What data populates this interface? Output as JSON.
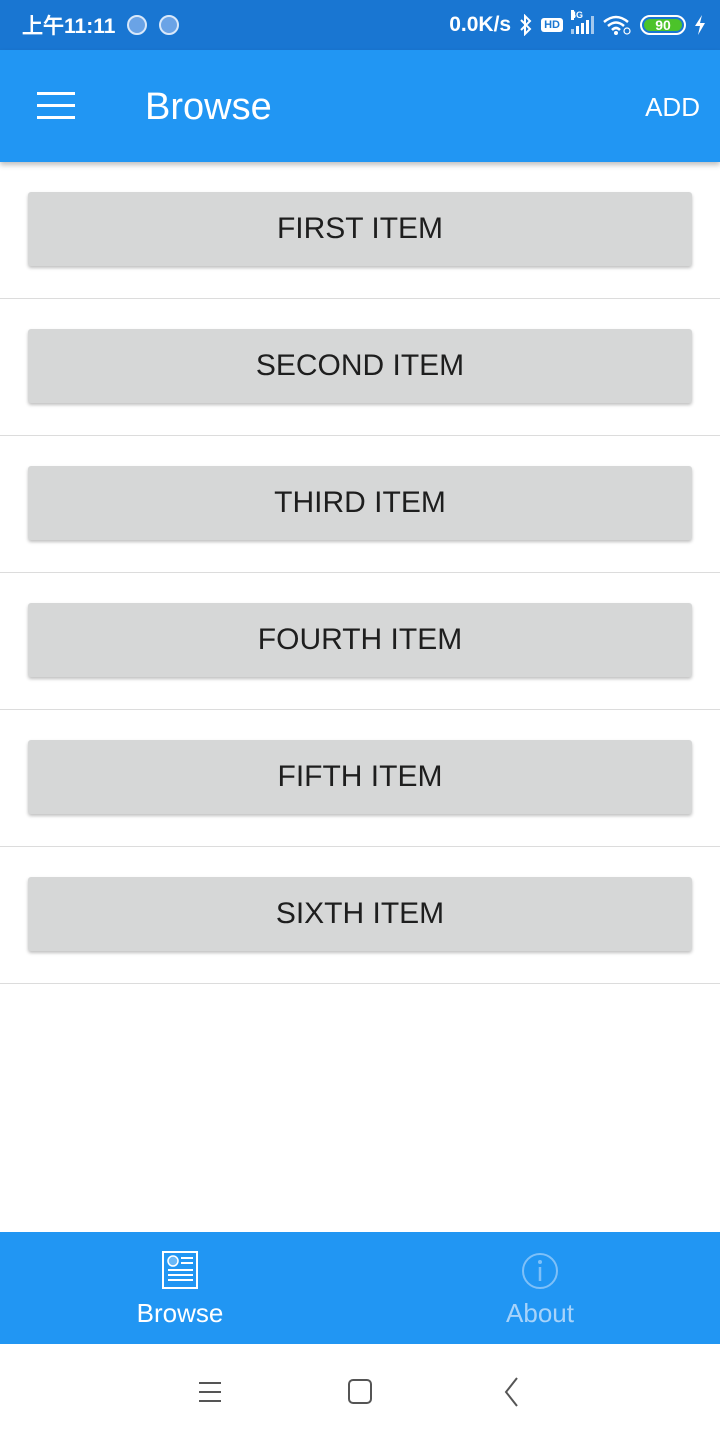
{
  "status_bar": {
    "time": "上午11:11",
    "net_speed": "0.0K/s",
    "hd_label": "HD",
    "network_type": "4G",
    "battery_level": "90",
    "icons": [
      "loading-icon",
      "loading-icon",
      "bluetooth-icon",
      "hd-icon",
      "signal-icon",
      "wifi-icon",
      "battery-icon",
      "charging-icon"
    ]
  },
  "app_bar": {
    "title": "Browse",
    "add_label": "ADD",
    "menu_icon": "hamburger-menu-icon"
  },
  "items": [
    {
      "label": "FIRST ITEM"
    },
    {
      "label": "SECOND ITEM"
    },
    {
      "label": "THIRD ITEM"
    },
    {
      "label": "FOURTH ITEM"
    },
    {
      "label": "FIFTH ITEM"
    },
    {
      "label": "SIXTH ITEM"
    }
  ],
  "bottom_nav": {
    "tabs": [
      {
        "label": "Browse",
        "icon": "newspaper-icon",
        "active": true
      },
      {
        "label": "About",
        "icon": "info-icon",
        "active": false
      }
    ]
  },
  "system_nav": {
    "buttons": [
      "recent-apps-icon",
      "home-icon",
      "back-icon"
    ]
  },
  "colors": {
    "primary": "#2196f3",
    "status_bar": "#1976d2",
    "item_button": "#d6d7d7",
    "inactive_tab": "#a7d3fa"
  }
}
